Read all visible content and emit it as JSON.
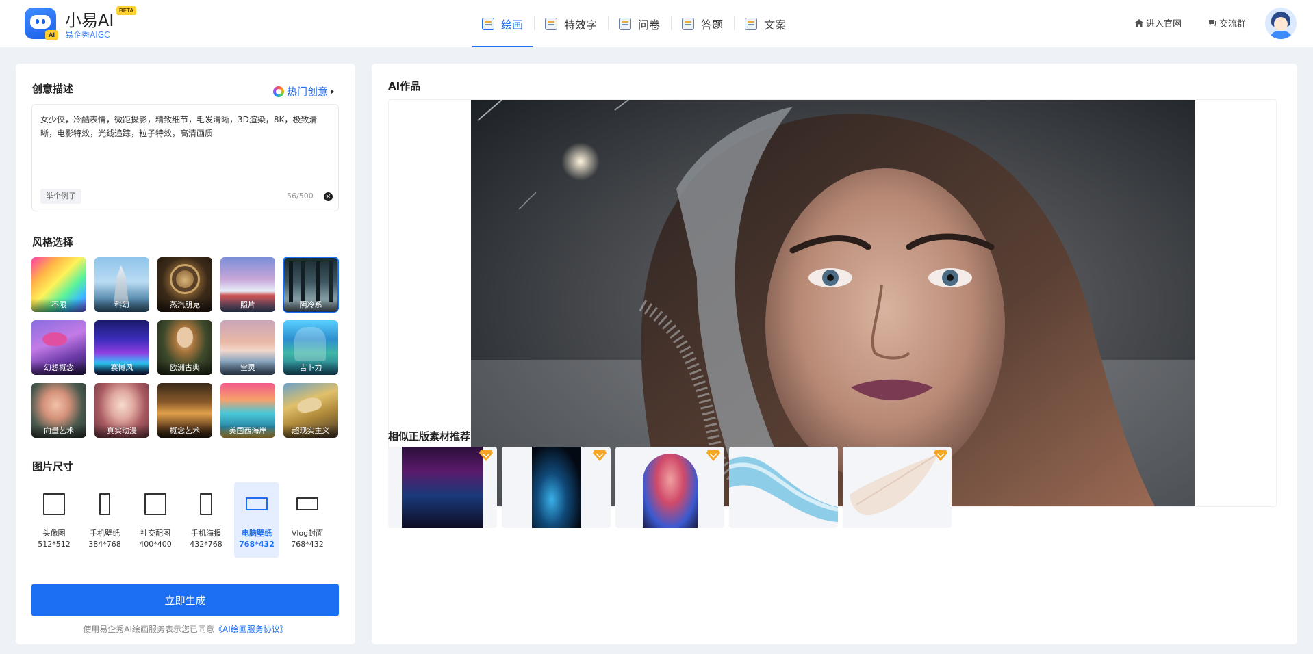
{
  "app": {
    "name": "小易AI",
    "badge": "BETA",
    "subtitle": "易企秀AIGC"
  },
  "nav": {
    "items": [
      {
        "label": "绘画",
        "active": true,
        "icon": "paint-icon"
      },
      {
        "label": "特效字",
        "active": false,
        "icon": "text-effect-icon"
      },
      {
        "label": "问卷",
        "active": false,
        "icon": "survey-icon"
      },
      {
        "label": "答题",
        "active": false,
        "icon": "quiz-icon"
      },
      {
        "label": "文案",
        "active": false,
        "icon": "copywriting-icon"
      }
    ],
    "official_site": "进入官网",
    "community": "交流群",
    "accent": "#1c6ef3"
  },
  "left": {
    "prompt_title": "创意描述",
    "hot_ideas": "热门创意",
    "prompt_text": "女少侠，冷酷表情，微距摄影，精致细节，毛发清晰，3D渲染，8K，极致清晰，电影特效，光线追踪，粒子特效，高清画质",
    "example_button": "举个例子",
    "counter": "56/500",
    "style_title": "风格选择",
    "styles": [
      {
        "label": "不限",
        "selected": false
      },
      {
        "label": "科幻",
        "selected": false
      },
      {
        "label": "蒸汽朋克",
        "selected": false
      },
      {
        "label": "照片",
        "selected": false
      },
      {
        "label": "阴冷系",
        "selected": true
      },
      {
        "label": "幻想概念",
        "selected": false
      },
      {
        "label": "赛博风",
        "selected": false
      },
      {
        "label": "欧洲古典",
        "selected": false
      },
      {
        "label": "空灵",
        "selected": false
      },
      {
        "label": "吉卜力",
        "selected": false
      },
      {
        "label": "向量艺术",
        "selected": false
      },
      {
        "label": "真实动漫",
        "selected": false
      },
      {
        "label": "概念艺术",
        "selected": false
      },
      {
        "label": "美国西海岸",
        "selected": false
      },
      {
        "label": "超现实主义",
        "selected": false
      }
    ],
    "size_title": "图片尺寸",
    "sizes": [
      {
        "name": "头像图",
        "dim": "512*512",
        "selected": false
      },
      {
        "name": "手机壁纸",
        "dim": "384*768",
        "selected": false
      },
      {
        "name": "社交配图",
        "dim": "400*400",
        "selected": false
      },
      {
        "name": "手机海报",
        "dim": "432*768",
        "selected": false
      },
      {
        "name": "电脑壁纸",
        "dim": "768*432",
        "selected": true
      },
      {
        "name": "Vlog封面",
        "dim": "768*432",
        "selected": false
      }
    ],
    "generate_button": "立即生成",
    "agreement_prefix": "使用易企秀AI绘画服务表示您已同意",
    "agreement_link": "《AI绘画服务协议》"
  },
  "right": {
    "works_title": "AI作品",
    "recommend_title": "相似正版素材推荐"
  }
}
